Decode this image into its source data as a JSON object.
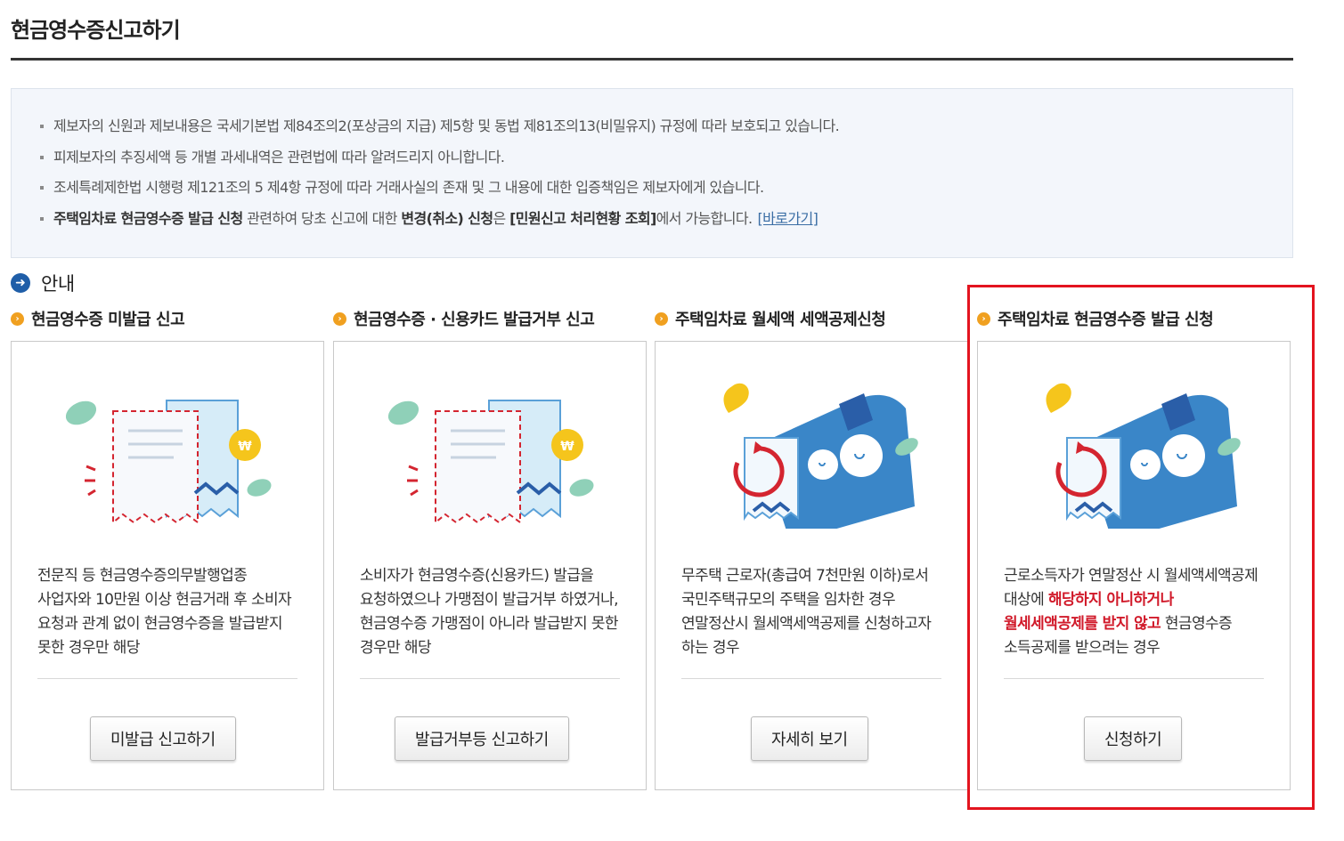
{
  "page": {
    "title": "현금영수증신고하기"
  },
  "notices": [
    {
      "segments": [
        {
          "text": "제보자의 신원과 제보내용은 국세기본법 제84조의2(포상금의 지급) 제5항 및 동법 제81조의13(비밀유지) 규정에 따라 보호되고 있습니다.",
          "bold": false
        }
      ]
    },
    {
      "segments": [
        {
          "text": "피제보자의 추징세액 등 개별 과세내역은 관련법에 따라 알려드리지 아니합니다.",
          "bold": false
        }
      ]
    },
    {
      "segments": [
        {
          "text": "조세특례제한법 시행령 제121조의 5 제4항 규정에 따라 거래사실의 존재 및 그 내용에 대한 입증책임은 제보자에게 있습니다.",
          "bold": false
        }
      ]
    },
    {
      "segments": [
        {
          "text": "주택임차료 현금영수증 발급 신청",
          "bold": true
        },
        {
          "text": " 관련하여 당초 신고에 대한 ",
          "bold": false
        },
        {
          "text": "변경(취소) 신청",
          "bold": true
        },
        {
          "text": "은 ",
          "bold": false
        },
        {
          "text": "[민원신고 처리현황 조회]",
          "bold": true
        },
        {
          "text": "에서 가능합니다.",
          "bold": false
        }
      ],
      "link": "[바로가기]"
    }
  ],
  "section": {
    "icon": "arrow-right-circle-icon",
    "label": "안내"
  },
  "cards": [
    {
      "title": "현금영수증 미발급 신고",
      "illustration": "receipt-coin-icon",
      "desc": [
        {
          "text": "전문직 등 현금영수증의무발행업종 사업자와 10만원 이상 현금거래 후 소비자 요청과 관계 없이 현금영수증을 발급받지 못한 경우만 해당",
          "hl": false
        }
      ],
      "button": "미발급 신고하기"
    },
    {
      "title": "현금영수증 · 신용카드 발급거부 신고",
      "illustration": "receipt-coin-icon",
      "desc": [
        {
          "text": "소비자가 현금영수증(신용카드) 발급을 요청하였으나 가맹점이 발급거부 하였거나, 현금영수증 가맹점이 아니라 발급받지 못한 경우만 해당",
          "hl": false
        }
      ],
      "button": "발급거부등 신고하기"
    },
    {
      "title": "주택임차료 월세액 세액공제신청",
      "illustration": "house-refund-icon",
      "desc": [
        {
          "text": "무주택 근로자(총급여 7천만원 이하)로서 국민주택규모의 주택을 임차한 경우 연말정산시 월세액세액공제를 신청하고자 하는 경우",
          "hl": false
        }
      ],
      "button": "자세히 보기"
    },
    {
      "title": "주택임차료 현금영수증 발급 신청",
      "illustration": "house-refund-icon",
      "desc": [
        {
          "text": "근로소득자가 연말정산 시 월세액세액공제 대상에 ",
          "hl": false
        },
        {
          "text": "해당하지 아니하거나 월세세액공제를 받지 않고",
          "hl": true
        },
        {
          "text": " 현금영수증 소득공제를 받으려는 경우",
          "hl": false
        }
      ],
      "button": "신청하기"
    }
  ],
  "colors": {
    "accent": "#1f5ea8",
    "highlight": "#e3141f",
    "emphasis": "#d11a2a",
    "head_dot": "#f0a020"
  }
}
